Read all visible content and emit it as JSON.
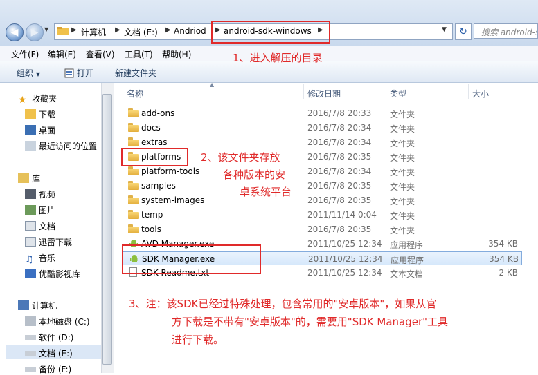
{
  "address_bar": {
    "crumbs": [
      "计算机",
      "文档 (E:)",
      "Andriod",
      "android-sdk-windows"
    ],
    "search_placeholder": "搜索 android-sdk-windows"
  },
  "menu": [
    "文件(F)",
    "编辑(E)",
    "查看(V)",
    "工具(T)",
    "帮助(H)"
  ],
  "toolbar": {
    "organize": "组织",
    "open": "打开",
    "new_folder": "新建文件夹"
  },
  "navigation": {
    "favorites": {
      "label": "收藏夹",
      "items": [
        "下载",
        "桌面",
        "最近访问的位置"
      ]
    },
    "libraries": {
      "label": "库",
      "items": [
        "视频",
        "图片",
        "文档",
        "迅雷下载",
        "音乐",
        "优酷影视库"
      ]
    },
    "computer": {
      "label": "计算机",
      "items": [
        "本地磁盘 (C:)",
        "软件 (D:)",
        "文档 (E:)",
        "备份 (F:)"
      ]
    }
  },
  "columns": [
    "名称",
    "修改日期",
    "类型",
    "大小"
  ],
  "files": [
    {
      "name": "add-ons",
      "date": "2016/7/8 20:33",
      "type": "文件夹",
      "size": "",
      "icon": "folder-icon"
    },
    {
      "name": "docs",
      "date": "2016/7/8 20:34",
      "type": "文件夹",
      "size": "",
      "icon": "folder-icon"
    },
    {
      "name": "extras",
      "date": "2016/7/8 20:34",
      "type": "文件夹",
      "size": "",
      "icon": "folder-icon"
    },
    {
      "name": "platforms",
      "date": "2016/7/8 20:35",
      "type": "文件夹",
      "size": "",
      "icon": "folder-icon"
    },
    {
      "name": "platform-tools",
      "date": "2016/7/8 20:34",
      "type": "文件夹",
      "size": "",
      "icon": "folder-icon"
    },
    {
      "name": "samples",
      "date": "2016/7/8 20:35",
      "type": "文件夹",
      "size": "",
      "icon": "folder-icon"
    },
    {
      "name": "system-images",
      "date": "2016/7/8 20:35",
      "type": "文件夹",
      "size": "",
      "icon": "folder-icon"
    },
    {
      "name": "temp",
      "date": "2011/11/14 0:04",
      "type": "文件夹",
      "size": "",
      "icon": "folder-icon"
    },
    {
      "name": "tools",
      "date": "2016/7/8 20:35",
      "type": "文件夹",
      "size": "",
      "icon": "folder-icon"
    },
    {
      "name": "AVD Manager.exe",
      "date": "2011/10/25 12:34",
      "type": "应用程序",
      "size": "354 KB",
      "icon": "android-icon"
    },
    {
      "name": "SDK Manager.exe",
      "date": "2011/10/25 12:34",
      "type": "应用程序",
      "size": "354 KB",
      "icon": "android-icon"
    },
    {
      "name": "SDK Readme.txt",
      "date": "2011/10/25 12:34",
      "type": "文本文档",
      "size": "2 KB",
      "icon": "text-file-icon"
    }
  ],
  "annotations": {
    "a1": "1、进入解压的目录",
    "a2_line1": "2、该文件夹存放",
    "a2_line2": "各种版本的安",
    "a2_line3": "卓系统平台",
    "a3_line1": "3、注：该SDK已经过特殊处理，包含常用的\"安卓版本\"，如果从官",
    "a3_line2": "方下载是不带有\"安卓版本\"的，需要用\"SDK Manager\"工具",
    "a3_line3": "进行下载。"
  },
  "colors": {
    "annotation": "#e02a2a",
    "selection": "#d6e8fb"
  }
}
